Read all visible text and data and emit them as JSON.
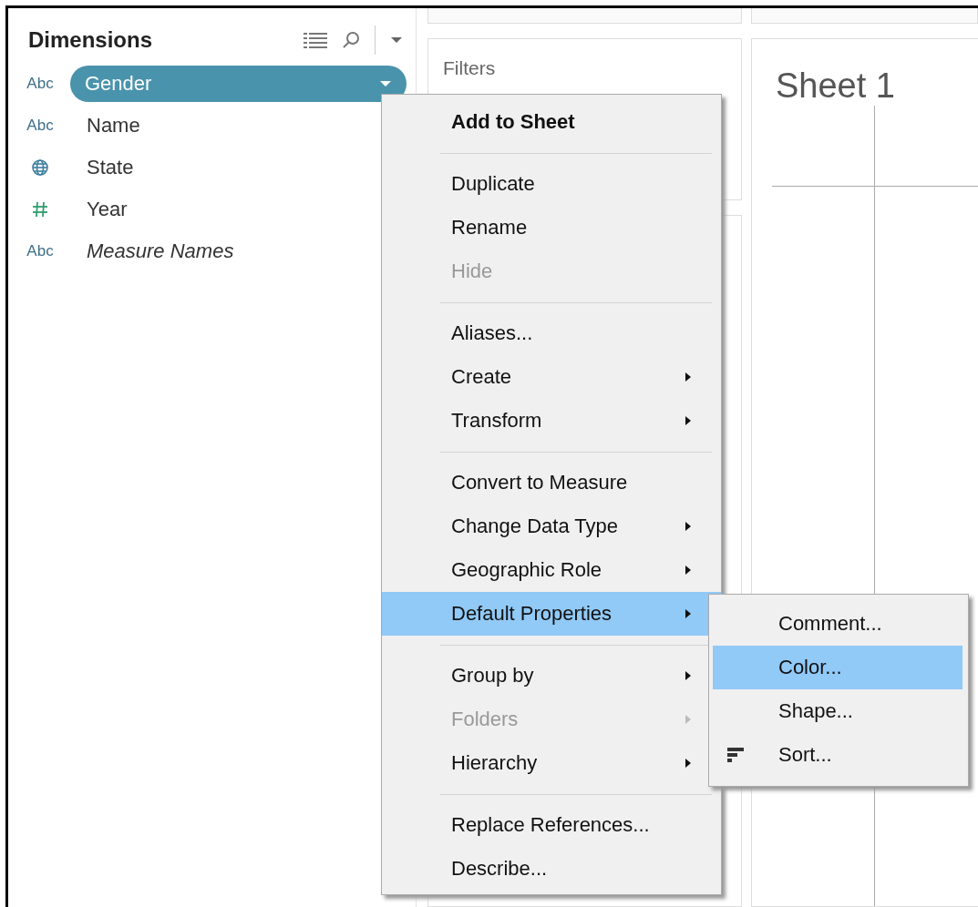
{
  "dimensions": {
    "title": "Dimensions",
    "fields": [
      {
        "name": "Gender",
        "kind": "text",
        "type_label": "Abc",
        "italic": false,
        "selected": true
      },
      {
        "name": "Name",
        "kind": "text",
        "type_label": "Abc",
        "italic": false,
        "selected": false
      },
      {
        "name": "State",
        "kind": "geo",
        "italic": false,
        "selected": false
      },
      {
        "name": "Year",
        "kind": "number",
        "italic": false,
        "selected": false
      },
      {
        "name": "Measure Names",
        "kind": "text",
        "type_label": "Abc",
        "italic": true,
        "selected": false
      }
    ]
  },
  "filters": {
    "title": "Filters"
  },
  "sheet": {
    "title": "Sheet 1"
  },
  "context_menu": {
    "items": [
      {
        "kind": "item",
        "label": "Add to Sheet",
        "bold": true,
        "disabled": false,
        "submenu": false,
        "selected": false
      },
      {
        "kind": "separator"
      },
      {
        "kind": "item",
        "label": "Duplicate",
        "bold": false,
        "disabled": false,
        "submenu": false,
        "selected": false
      },
      {
        "kind": "item",
        "label": "Rename",
        "bold": false,
        "disabled": false,
        "submenu": false,
        "selected": false
      },
      {
        "kind": "item",
        "label": "Hide",
        "bold": false,
        "disabled": true,
        "submenu": false,
        "selected": false
      },
      {
        "kind": "separator"
      },
      {
        "kind": "item",
        "label": "Aliases...",
        "bold": false,
        "disabled": false,
        "submenu": false,
        "selected": false
      },
      {
        "kind": "item",
        "label": "Create",
        "bold": false,
        "disabled": false,
        "submenu": true,
        "selected": false
      },
      {
        "kind": "item",
        "label": "Transform",
        "bold": false,
        "disabled": false,
        "submenu": true,
        "selected": false
      },
      {
        "kind": "separator"
      },
      {
        "kind": "item",
        "label": "Convert to Measure",
        "bold": false,
        "disabled": false,
        "submenu": false,
        "selected": false
      },
      {
        "kind": "item",
        "label": "Change Data Type",
        "bold": false,
        "disabled": false,
        "submenu": true,
        "selected": false
      },
      {
        "kind": "item",
        "label": "Geographic Role",
        "bold": false,
        "disabled": false,
        "submenu": true,
        "selected": false
      },
      {
        "kind": "item",
        "label": "Default Properties",
        "bold": false,
        "disabled": false,
        "submenu": true,
        "selected": true
      },
      {
        "kind": "separator"
      },
      {
        "kind": "item",
        "label": "Group by",
        "bold": false,
        "disabled": false,
        "submenu": true,
        "selected": false
      },
      {
        "kind": "item",
        "label": "Folders",
        "bold": false,
        "disabled": true,
        "submenu": true,
        "selected": false
      },
      {
        "kind": "item",
        "label": "Hierarchy",
        "bold": false,
        "disabled": false,
        "submenu": true,
        "selected": false
      },
      {
        "kind": "separator"
      },
      {
        "kind": "item",
        "label": "Replace References...",
        "bold": false,
        "disabled": false,
        "submenu": false,
        "selected": false
      },
      {
        "kind": "item",
        "label": "Describe...",
        "bold": false,
        "disabled": false,
        "submenu": false,
        "selected": false
      }
    ]
  },
  "submenu": {
    "items": [
      {
        "kind": "item",
        "label": "Comment...",
        "selected": false
      },
      {
        "kind": "item",
        "label": "Color...",
        "selected": true
      },
      {
        "kind": "item",
        "label": "Shape...",
        "selected": false
      },
      {
        "kind": "sort",
        "label": "Sort...",
        "selected": false
      }
    ]
  }
}
